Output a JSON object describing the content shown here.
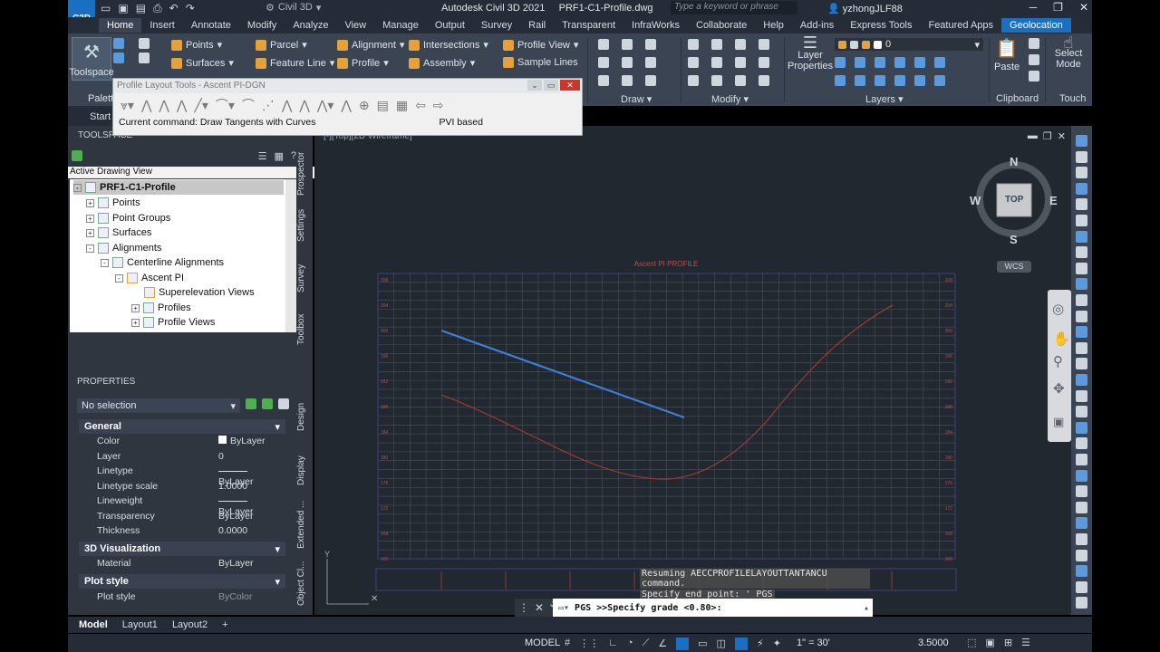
{
  "titlebar": {
    "app_badge": "C3D",
    "workspace": "Civil 3D",
    "app_title": "Autodesk Civil 3D 2021",
    "file_name": "PRF1-C1-Profile.dwg",
    "search_placeholder": "Type a keyword or phrase",
    "user": "yzhongJLF88"
  },
  "tabs": [
    "Home",
    "Insert",
    "Annotate",
    "Modify",
    "Analyze",
    "View",
    "Manage",
    "Output",
    "Survey",
    "Rail",
    "Transparent",
    "InfraWorks",
    "Collaborate",
    "Help",
    "Add-ins",
    "Express Tools",
    "Featured Apps",
    "Geolocation"
  ],
  "ribbon": {
    "toolspace": "Toolspace",
    "palettes": "Palett",
    "points": "Points",
    "surfaces": "Surfaces",
    "parcel": "Parcel",
    "feature_line": "Feature Line",
    "alignment": "Alignment",
    "profile": "Profile",
    "intersections": "Intersections",
    "assembly": "Assembly",
    "profile_view": "Profile View",
    "sample_lines": "Sample Lines",
    "draw_label": "Draw",
    "modify_label": "Modify",
    "layer_properties": "Layer Properties",
    "layer_value": "0",
    "layers_label": "Layers",
    "paste": "Paste",
    "clipboard_label": "Clipboard",
    "select_mode": "Select Mode",
    "touch_label": "Touch"
  },
  "profile_layout_tools": {
    "title": "Profile Layout Tools - Ascent PI-DGN",
    "current_command": "Current command: Draw Tangents with Curves",
    "mode": "PVI based"
  },
  "start_tab": "Start",
  "toolspace": {
    "header": "TOOLSPACE",
    "view_selector": "Active Drawing View",
    "tree": [
      {
        "label": "PRF1-C1-Profile",
        "level": 0,
        "expander": "-",
        "selected": true
      },
      {
        "label": "Points",
        "level": 1,
        "expander": "+"
      },
      {
        "label": "Point Groups",
        "level": 1,
        "expander": "+"
      },
      {
        "label": "Surfaces",
        "level": 1,
        "expander": "+"
      },
      {
        "label": "Alignments",
        "level": 1,
        "expander": "-"
      },
      {
        "label": "Centerline Alignments",
        "level": 2,
        "expander": "-"
      },
      {
        "label": "Ascent PI",
        "level": 3,
        "expander": "-"
      },
      {
        "label": "Superelevation Views",
        "level": 4,
        "expander": ""
      },
      {
        "label": "Profiles",
        "level": 4,
        "expander": "+"
      },
      {
        "label": "Profile Views",
        "level": 4,
        "expander": "+"
      }
    ],
    "vertical_tabs": [
      "Prospector",
      "Settings",
      "Survey",
      "Toolbox"
    ]
  },
  "properties": {
    "header": "PROPERTIES",
    "selection": "No selection",
    "sections": [
      {
        "title": "General",
        "rows": [
          {
            "key": "Color",
            "value": "ByLayer"
          },
          {
            "key": "Layer",
            "value": "0"
          },
          {
            "key": "Linetype",
            "value": "ByLayer"
          },
          {
            "key": "Linetype scale",
            "value": "1.0000"
          },
          {
            "key": "Lineweight",
            "value": "ByLayer"
          },
          {
            "key": "Transparency",
            "value": "ByLayer"
          },
          {
            "key": "Thickness",
            "value": "0.0000"
          }
        ]
      },
      {
        "title": "3D Visualization",
        "rows": [
          {
            "key": "Material",
            "value": "ByLayer"
          }
        ]
      },
      {
        "title": "Plot style",
        "rows": [
          {
            "key": "Plot style",
            "value": "ByColor"
          }
        ]
      }
    ],
    "vertical_tabs": [
      "Design",
      "Display",
      "Extended ...",
      "Object Cl..."
    ]
  },
  "viewport": {
    "label": "[-][Top][2D Wireframe]",
    "profile_title": "Ascent PI PROFILE",
    "compass": {
      "n": "N",
      "s": "S",
      "e": "E",
      "w": "W",
      "cube": "TOP",
      "wcs": "WCS"
    },
    "left_ticks": [
      "208",
      "204",
      "200",
      "196",
      "192",
      "188",
      "184",
      "180",
      "176",
      "172",
      "168",
      "165"
    ],
    "right_ticks": [
      "208",
      "204",
      "200",
      "196",
      "192",
      "188",
      "184",
      "180",
      "176",
      "172",
      "168",
      "165"
    ]
  },
  "command": {
    "history": [
      "Resuming AECCPROFILELAYOUTTANTANCU command.",
      "Specify end point: '_PGS"
    ],
    "prompt": "PGS >>Specify grade <0.80>:"
  },
  "layouts": [
    "Model",
    "Layout1",
    "Layout2"
  ],
  "status": {
    "space": "MODEL",
    "scale": "1\" = 30'",
    "value": "3.5000"
  },
  "colors": {
    "chrome_dark": "#252c37",
    "panel": "#3b4452",
    "canvas": "#212830",
    "accent": "#1b6fc2",
    "profile_blue": "#3d7fd9",
    "ground_red": "#a83a35"
  }
}
